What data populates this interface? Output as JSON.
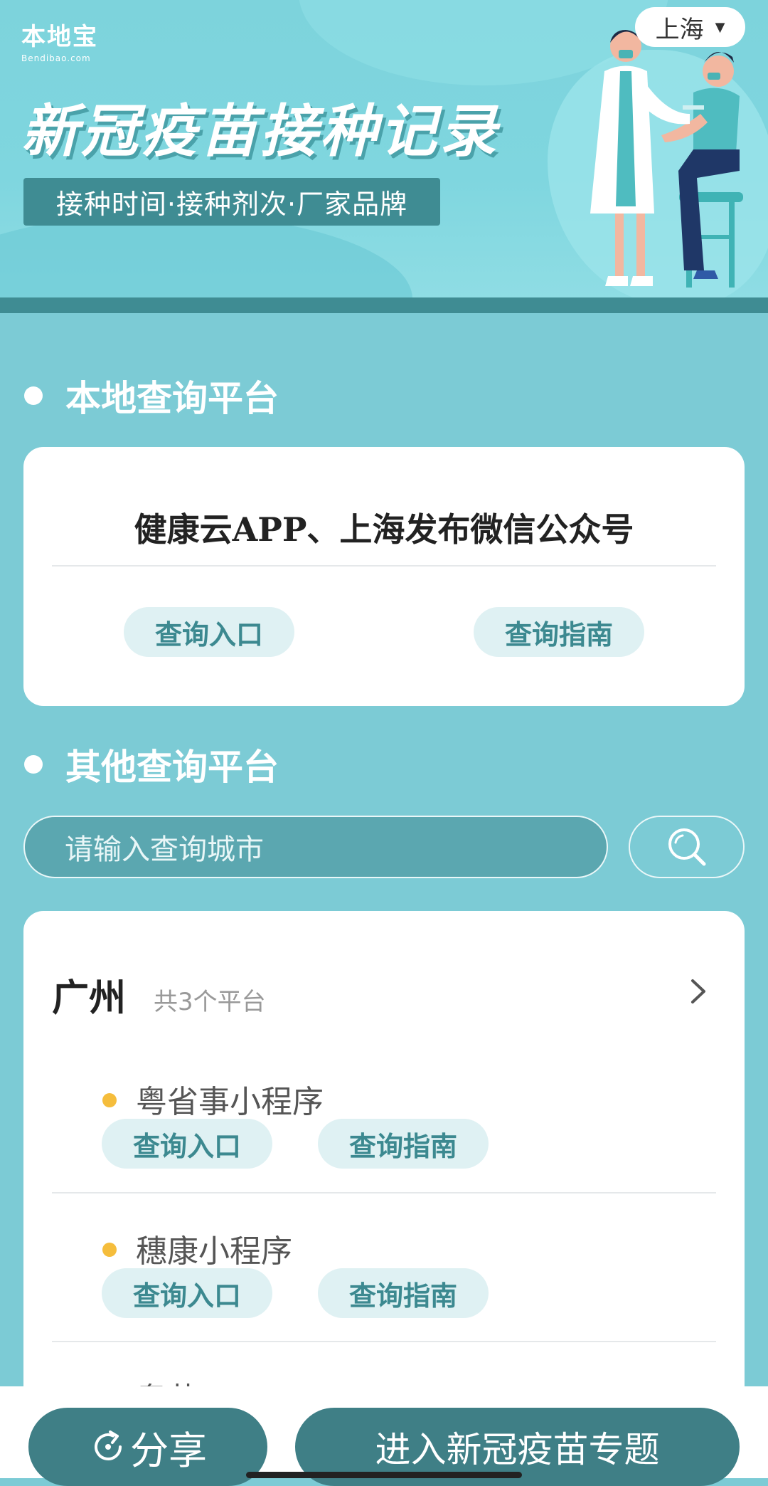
{
  "banner": {
    "logo_cn": "本地宝",
    "logo_en": "Bendibao.com",
    "title": "新冠疫苗接种记录",
    "subtitle": "接种时间·接种剂次·厂家品牌",
    "city": "上海"
  },
  "local_section": {
    "title": "本地查询平台",
    "platform_name": "健康云APP、上海发布微信公众号",
    "entry_label": "查询入口",
    "guide_label": "查询指南"
  },
  "other_section": {
    "title": "其他查询平台",
    "search_placeholder": "请输入查询城市",
    "city_name": "广州",
    "city_count": "共3个平台",
    "platforms": [
      {
        "name": "粤省事小程序",
        "entry_label": "查询入口",
        "guide_label": "查询指南"
      },
      {
        "name": "穗康小程序",
        "entry_label": "查询入口",
        "guide_label": "查询指南"
      },
      {
        "name": "粤苗APP"
      }
    ]
  },
  "bottom": {
    "share_label": "分享",
    "topic_label": "进入新冠疫苗专题"
  },
  "colors": {
    "page_bg": "#7ccbd5",
    "accent": "#3f7f86",
    "pill_bg": "#dff1f3",
    "dot_yellow": "#f5bd3c"
  }
}
